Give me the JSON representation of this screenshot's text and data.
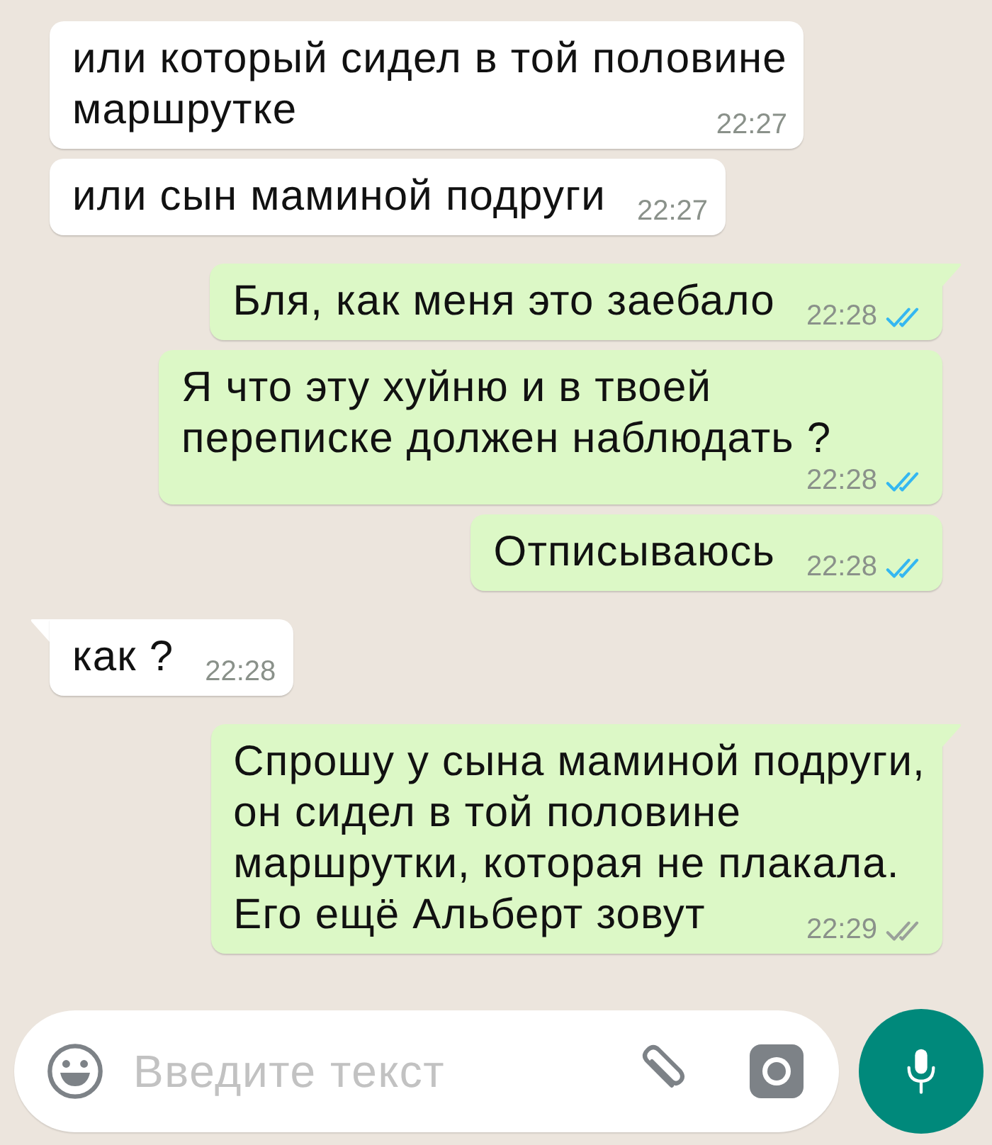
{
  "messages": [
    {
      "outgoing": false,
      "tail": false,
      "lines": [
        "или который сидел в той половине",
        "маршрутке"
      ],
      "time": "22:27"
    },
    {
      "outgoing": false,
      "tail": false,
      "lines": [
        "или сын маминой подруги"
      ],
      "time": "22:27"
    },
    {
      "outgoing": true,
      "tail": true,
      "lines": [
        "Бля, как меня это заебало"
      ],
      "time": "22:28",
      "read": true
    },
    {
      "outgoing": true,
      "tail": false,
      "lines": [
        "Я что эту хуйню и в твоей",
        "переписке должен наблюдать ?"
      ],
      "time": "22:28",
      "read": true
    },
    {
      "outgoing": true,
      "tail": false,
      "lines": [
        "Отписываюсь"
      ],
      "time": "22:28",
      "read": true
    },
    {
      "outgoing": false,
      "tail": true,
      "lines": [
        "как ?"
      ],
      "time": "22:28"
    },
    {
      "outgoing": true,
      "tail": true,
      "lines": [
        "Спрошу у сына маминой подруги,",
        "он сидел в той половине",
        "маршрутки, которая не плакала.",
        "Его ещё Альберт зовут"
      ],
      "time": "22:29",
      "read": false
    }
  ],
  "composer": {
    "placeholder": "Введите текст"
  }
}
